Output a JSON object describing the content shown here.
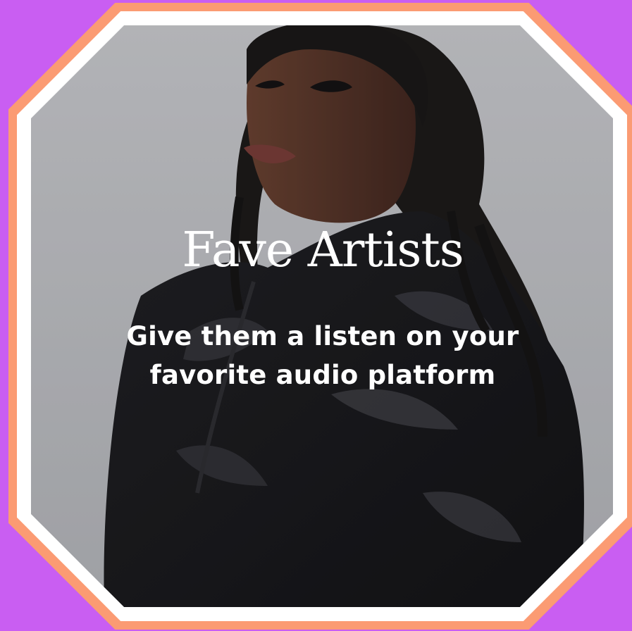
{
  "card": {
    "title": "Fave Artists",
    "subtitle_line1": "Give them a listen on your",
    "subtitle_line2": "favorite audio platform"
  },
  "colors": {
    "background": "#c95ef2",
    "outer_ring": "#fb9b73",
    "inner_ring": "#ffffff",
    "text": "#ffffff"
  },
  "image": {
    "icon": "artist-portrait-photo"
  }
}
